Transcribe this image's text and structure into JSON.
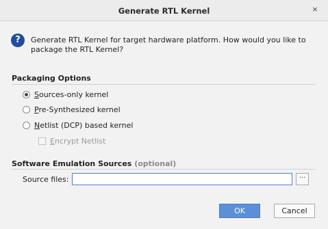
{
  "window": {
    "title": "Generate RTL Kernel",
    "close_glyph": "×"
  },
  "message": {
    "icon": "question-icon",
    "icon_glyph": "?",
    "text": "Generate RTL Kernel for target hardware platform. How would you like to package the RTL Kernel?"
  },
  "packaging": {
    "title": "Packaging Options",
    "options": [
      {
        "mnemonic": "S",
        "rest": "ources-only kernel",
        "checked": true
      },
      {
        "mnemonic": "P",
        "rest": "re-Synthesized kernel",
        "checked": false
      },
      {
        "mnemonic": "N",
        "rest": "etlist (DCP) based kernel",
        "checked": false
      }
    ],
    "encrypt": {
      "mnemonic": "E",
      "rest": "ncrypt Netlist",
      "checked": false,
      "enabled": false
    }
  },
  "emulation": {
    "title": "Software Emulation Sources",
    "optional": "(optional)",
    "source_label": "Source files:",
    "source_value": "",
    "browse_glyph": "···"
  },
  "buttons": {
    "ok": "OK",
    "cancel": "Cancel"
  },
  "colors": {
    "accent": "#5b8fd6",
    "question_icon": "#1f4e9e"
  }
}
